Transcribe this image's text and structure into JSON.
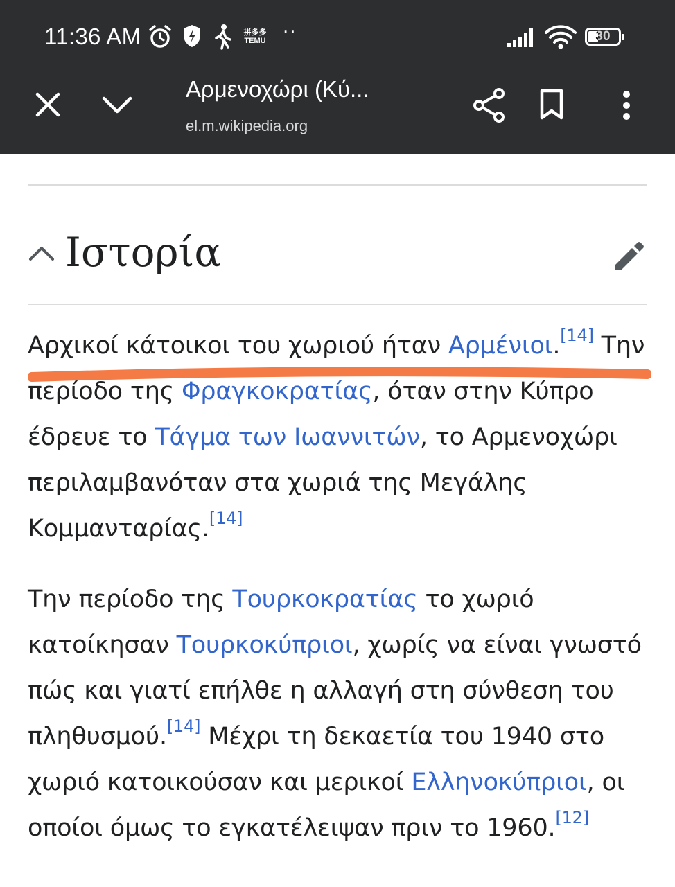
{
  "status_bar": {
    "time": "11:36 AM",
    "temu_label_top": "拼多多",
    "temu_label_bottom": "TEMU",
    "more_dots": "··",
    "battery_level": "30",
    "icons": [
      "alarm-icon",
      "shield-bolt-icon",
      "walking-icon",
      "temu-icon",
      "signal-icon",
      "wifi-icon",
      "battery-icon"
    ]
  },
  "browser_toolbar": {
    "title": "Αρμενοχώρι (Κύ...",
    "url": "el.m.wikipedia.org",
    "icons": [
      "close-icon",
      "chevron-down-icon",
      "share-icon",
      "bookmark-icon",
      "more-vert-icon"
    ]
  },
  "section": {
    "title": "Ιστορία",
    "icons": [
      "chevron-up-icon",
      "edit-pencil-icon"
    ]
  },
  "article": {
    "p1": {
      "t1": "Αρχικοί κάτοικοι του χωριού ήταν ",
      "link1": "Αρμένιοι",
      "t2": ".",
      "ref1": "[14]",
      "t3": " Την περίοδο της ",
      "link2": "Φραγκοκρατίας",
      "t4": ", όταν στην Κύπρο έδρευε το ",
      "link3": "Τάγμα των Ιωαννιτών",
      "t5": ", το Αρμενοχώρι περιλαμβανόταν στα χωριά της Μεγάλης Κομμανταρίας.",
      "ref2": "[14]"
    },
    "p2": {
      "t1": "Την περίοδο της ",
      "link1": "Τουρκοκρατίας",
      "t2": " το χωριό κατοίκησαν ",
      "link2": "Τουρκοκύπριοι",
      "t3": ", χωρίς να είναι γνωστό πώς και γιατί επήλθε η αλλαγή στη σύνθεση του πληθυσμού.",
      "ref1": "[14]",
      "t4": " Μέχρι τη δεκαετία του 1940 στο χωριό κατοικούσαν και μερικοί ",
      "link3": "Ελληνοκύπριοι",
      "t5": ", οι οποίοι όμως το εγκατέλειψαν πριν το 1960.",
      "ref2": "[12]"
    }
  },
  "colors": {
    "toolbar_bg": "#2d2e30",
    "link": "#3366cc",
    "text": "#202122",
    "highlight_stroke": "#f47a46"
  }
}
